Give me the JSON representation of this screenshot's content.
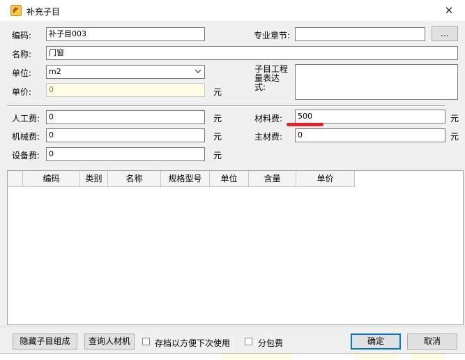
{
  "window": {
    "title": "补充子目",
    "close_glyph": "✕"
  },
  "form": {
    "code_label": "编码:",
    "code_value": "补子目003",
    "chapter_label": "专业章节:",
    "chapter_value": "",
    "browse_label": "...",
    "name_label": "名称:",
    "name_value": "门窗",
    "unit_label": "单位:",
    "unit_value": "m2",
    "expr_label": "子目工程量表达式:",
    "expr_value": "",
    "price_label": "单价:",
    "price_value": "0",
    "labor_label": "人工费:",
    "labor_value": "0",
    "material_label": "材料费:",
    "material_value": "500",
    "machine_label": "机械费:",
    "machine_value": "0",
    "main_material_label": "主材费:",
    "main_material_value": "0",
    "equipment_label": "设备费:",
    "equipment_value": "0",
    "yuan": "元"
  },
  "grid": {
    "columns": [
      "编码",
      "类别",
      "名称",
      "规格型号",
      "单位",
      "含量",
      "单价"
    ]
  },
  "footer": {
    "hide_button": "隐藏子目组成",
    "query_button": "查询人材机",
    "archive_checkbox": "存档以方便下次使用",
    "subcontract_checkbox": "分包费",
    "ok_button": "确定",
    "cancel_button": "取消"
  },
  "colors": {
    "annotation": "#e8212a",
    "readonly_bg": "#fefee6",
    "primary_border": "#0078d7"
  }
}
